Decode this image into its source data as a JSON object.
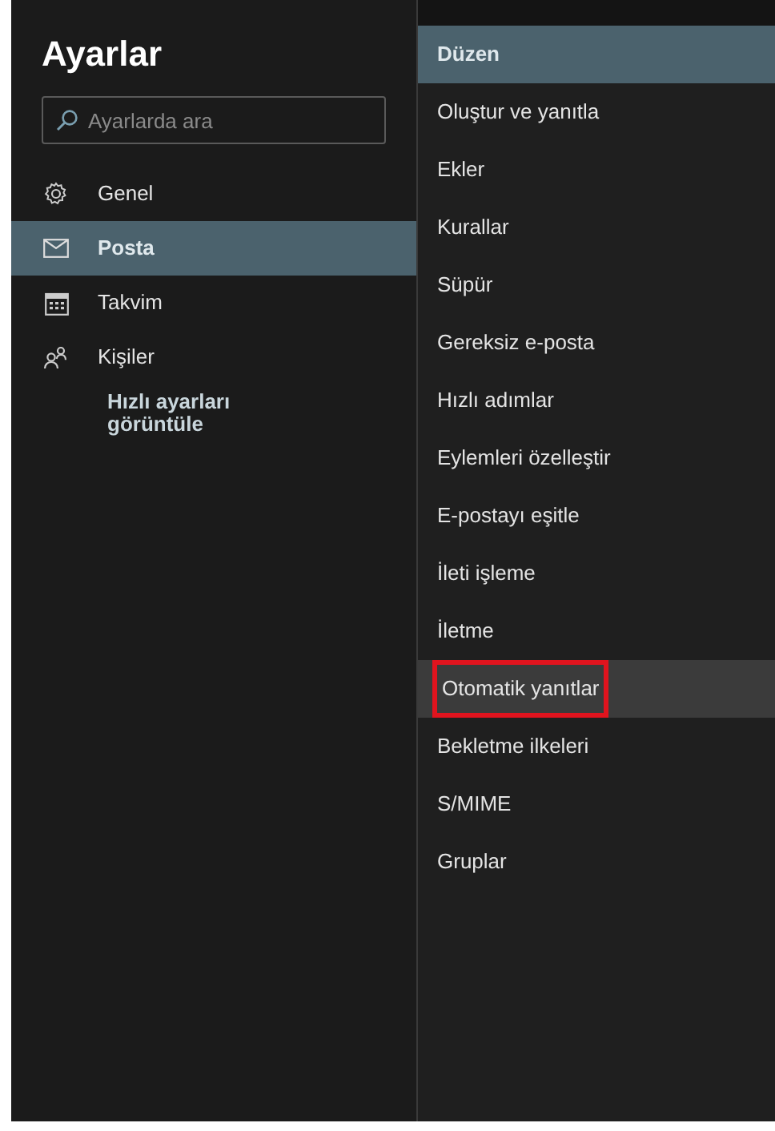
{
  "sidebar": {
    "title": "Ayarlar",
    "search": {
      "placeholder": "Ayarlarda ara"
    },
    "items": [
      {
        "kind": "gear",
        "label": "Genel",
        "selected": false
      },
      {
        "kind": "mail",
        "label": "Posta",
        "selected": true
      },
      {
        "kind": "calendar",
        "label": "Takvim",
        "selected": false
      },
      {
        "kind": "people",
        "label": "Kişiler",
        "selected": false
      },
      {
        "kind": "link",
        "label": "Hızlı ayarları görüntüle",
        "selected": false
      }
    ]
  },
  "mail_settings": {
    "items": [
      {
        "label": "Düzen",
        "selected": true,
        "hovered": false,
        "outlined": false
      },
      {
        "label": "Oluştur ve yanıtla",
        "selected": false,
        "hovered": false,
        "outlined": false
      },
      {
        "label": "Ekler",
        "selected": false,
        "hovered": false,
        "outlined": false
      },
      {
        "label": "Kurallar",
        "selected": false,
        "hovered": false,
        "outlined": false
      },
      {
        "label": "Süpür",
        "selected": false,
        "hovered": false,
        "outlined": false
      },
      {
        "label": "Gereksiz e-posta",
        "selected": false,
        "hovered": false,
        "outlined": false
      },
      {
        "label": "Hızlı adımlar",
        "selected": false,
        "hovered": false,
        "outlined": false
      },
      {
        "label": "Eylemleri özelleştir",
        "selected": false,
        "hovered": false,
        "outlined": false
      },
      {
        "label": "E-postayı eşitle",
        "selected": false,
        "hovered": false,
        "outlined": false
      },
      {
        "label": "İleti işleme",
        "selected": false,
        "hovered": false,
        "outlined": false
      },
      {
        "label": "İletme",
        "selected": false,
        "hovered": false,
        "outlined": false
      },
      {
        "label": "Otomatik yanıtlar",
        "selected": false,
        "hovered": true,
        "outlined": true
      },
      {
        "label": "Bekletme ilkeleri",
        "selected": false,
        "hovered": false,
        "outlined": false
      },
      {
        "label": "S/MIME",
        "selected": false,
        "hovered": false,
        "outlined": false
      },
      {
        "label": "Gruplar",
        "selected": false,
        "hovered": false,
        "outlined": false
      }
    ]
  }
}
